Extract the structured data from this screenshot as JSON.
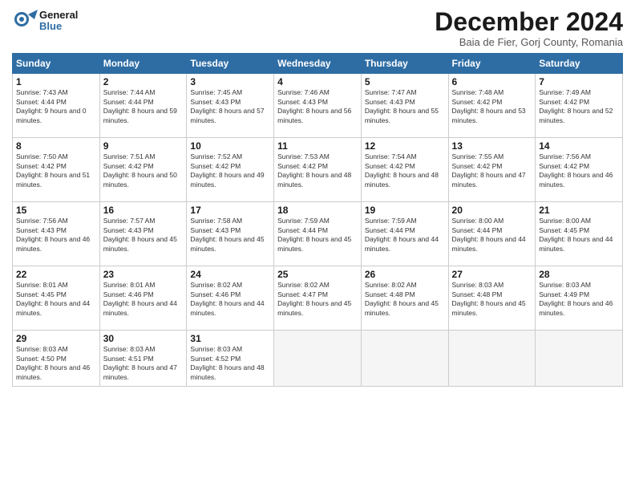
{
  "header": {
    "logo": {
      "line1": "General",
      "line2": "Blue"
    },
    "title": "December 2024",
    "subtitle": "Baia de Fier, Gorj County, Romania"
  },
  "weekdays": [
    "Sunday",
    "Monday",
    "Tuesday",
    "Wednesday",
    "Thursday",
    "Friday",
    "Saturday"
  ],
  "days": [
    {
      "date": null,
      "number": "",
      "sunrise": "",
      "sunset": "",
      "daylight": ""
    },
    {
      "date": null,
      "number": "",
      "sunrise": "",
      "sunset": "",
      "daylight": ""
    },
    {
      "date": null,
      "number": "",
      "sunrise": "",
      "sunset": "",
      "daylight": ""
    },
    {
      "date": null,
      "number": "",
      "sunrise": "",
      "sunset": "",
      "daylight": ""
    },
    {
      "date": null,
      "number": "",
      "sunrise": "",
      "sunset": "",
      "daylight": ""
    },
    {
      "date": null,
      "number": "",
      "sunrise": "",
      "sunset": "",
      "daylight": ""
    },
    {
      "number": "1",
      "sunrise": "Sunrise: 7:43 AM",
      "sunset": "Sunset: 4:44 PM",
      "daylight": "Daylight: 9 hours and 0 minutes."
    },
    {
      "number": "2",
      "sunrise": "Sunrise: 7:44 AM",
      "sunset": "Sunset: 4:44 PM",
      "daylight": "Daylight: 8 hours and 59 minutes."
    },
    {
      "number": "3",
      "sunrise": "Sunrise: 7:45 AM",
      "sunset": "Sunset: 4:43 PM",
      "daylight": "Daylight: 8 hours and 57 minutes."
    },
    {
      "number": "4",
      "sunrise": "Sunrise: 7:46 AM",
      "sunset": "Sunset: 4:43 PM",
      "daylight": "Daylight: 8 hours and 56 minutes."
    },
    {
      "number": "5",
      "sunrise": "Sunrise: 7:47 AM",
      "sunset": "Sunset: 4:43 PM",
      "daylight": "Daylight: 8 hours and 55 minutes."
    },
    {
      "number": "6",
      "sunrise": "Sunrise: 7:48 AM",
      "sunset": "Sunset: 4:42 PM",
      "daylight": "Daylight: 8 hours and 53 minutes."
    },
    {
      "number": "7",
      "sunrise": "Sunrise: 7:49 AM",
      "sunset": "Sunset: 4:42 PM",
      "daylight": "Daylight: 8 hours and 52 minutes."
    },
    {
      "number": "8",
      "sunrise": "Sunrise: 7:50 AM",
      "sunset": "Sunset: 4:42 PM",
      "daylight": "Daylight: 8 hours and 51 minutes."
    },
    {
      "number": "9",
      "sunrise": "Sunrise: 7:51 AM",
      "sunset": "Sunset: 4:42 PM",
      "daylight": "Daylight: 8 hours and 50 minutes."
    },
    {
      "number": "10",
      "sunrise": "Sunrise: 7:52 AM",
      "sunset": "Sunset: 4:42 PM",
      "daylight": "Daylight: 8 hours and 49 minutes."
    },
    {
      "number": "11",
      "sunrise": "Sunrise: 7:53 AM",
      "sunset": "Sunset: 4:42 PM",
      "daylight": "Daylight: 8 hours and 48 minutes."
    },
    {
      "number": "12",
      "sunrise": "Sunrise: 7:54 AM",
      "sunset": "Sunset: 4:42 PM",
      "daylight": "Daylight: 8 hours and 48 minutes."
    },
    {
      "number": "13",
      "sunrise": "Sunrise: 7:55 AM",
      "sunset": "Sunset: 4:42 PM",
      "daylight": "Daylight: 8 hours and 47 minutes."
    },
    {
      "number": "14",
      "sunrise": "Sunrise: 7:56 AM",
      "sunset": "Sunset: 4:42 PM",
      "daylight": "Daylight: 8 hours and 46 minutes."
    },
    {
      "number": "15",
      "sunrise": "Sunrise: 7:56 AM",
      "sunset": "Sunset: 4:43 PM",
      "daylight": "Daylight: 8 hours and 46 minutes."
    },
    {
      "number": "16",
      "sunrise": "Sunrise: 7:57 AM",
      "sunset": "Sunset: 4:43 PM",
      "daylight": "Daylight: 8 hours and 45 minutes."
    },
    {
      "number": "17",
      "sunrise": "Sunrise: 7:58 AM",
      "sunset": "Sunset: 4:43 PM",
      "daylight": "Daylight: 8 hours and 45 minutes."
    },
    {
      "number": "18",
      "sunrise": "Sunrise: 7:59 AM",
      "sunset": "Sunset: 4:44 PM",
      "daylight": "Daylight: 8 hours and 45 minutes."
    },
    {
      "number": "19",
      "sunrise": "Sunrise: 7:59 AM",
      "sunset": "Sunset: 4:44 PM",
      "daylight": "Daylight: 8 hours and 44 minutes."
    },
    {
      "number": "20",
      "sunrise": "Sunrise: 8:00 AM",
      "sunset": "Sunset: 4:44 PM",
      "daylight": "Daylight: 8 hours and 44 minutes."
    },
    {
      "number": "21",
      "sunrise": "Sunrise: 8:00 AM",
      "sunset": "Sunset: 4:45 PM",
      "daylight": "Daylight: 8 hours and 44 minutes."
    },
    {
      "number": "22",
      "sunrise": "Sunrise: 8:01 AM",
      "sunset": "Sunset: 4:45 PM",
      "daylight": "Daylight: 8 hours and 44 minutes."
    },
    {
      "number": "23",
      "sunrise": "Sunrise: 8:01 AM",
      "sunset": "Sunset: 4:46 PM",
      "daylight": "Daylight: 8 hours and 44 minutes."
    },
    {
      "number": "24",
      "sunrise": "Sunrise: 8:02 AM",
      "sunset": "Sunset: 4:46 PM",
      "daylight": "Daylight: 8 hours and 44 minutes."
    },
    {
      "number": "25",
      "sunrise": "Sunrise: 8:02 AM",
      "sunset": "Sunset: 4:47 PM",
      "daylight": "Daylight: 8 hours and 45 minutes."
    },
    {
      "number": "26",
      "sunrise": "Sunrise: 8:02 AM",
      "sunset": "Sunset: 4:48 PM",
      "daylight": "Daylight: 8 hours and 45 minutes."
    },
    {
      "number": "27",
      "sunrise": "Sunrise: 8:03 AM",
      "sunset": "Sunset: 4:48 PM",
      "daylight": "Daylight: 8 hours and 45 minutes."
    },
    {
      "number": "28",
      "sunrise": "Sunrise: 8:03 AM",
      "sunset": "Sunset: 4:49 PM",
      "daylight": "Daylight: 8 hours and 46 minutes."
    },
    {
      "number": "29",
      "sunrise": "Sunrise: 8:03 AM",
      "sunset": "Sunset: 4:50 PM",
      "daylight": "Daylight: 8 hours and 46 minutes."
    },
    {
      "number": "30",
      "sunrise": "Sunrise: 8:03 AM",
      "sunset": "Sunset: 4:51 PM",
      "daylight": "Daylight: 8 hours and 47 minutes."
    },
    {
      "number": "31",
      "sunrise": "Sunrise: 8:03 AM",
      "sunset": "Sunset: 4:52 PM",
      "daylight": "Daylight: 8 hours and 48 minutes."
    },
    {
      "date": null,
      "number": "",
      "sunrise": "",
      "sunset": "",
      "daylight": ""
    },
    {
      "date": null,
      "number": "",
      "sunrise": "",
      "sunset": "",
      "daylight": ""
    },
    {
      "date": null,
      "number": "",
      "sunrise": "",
      "sunset": "",
      "daylight": ""
    },
    {
      "date": null,
      "number": "",
      "sunrise": "",
      "sunset": "",
      "daylight": ""
    }
  ]
}
